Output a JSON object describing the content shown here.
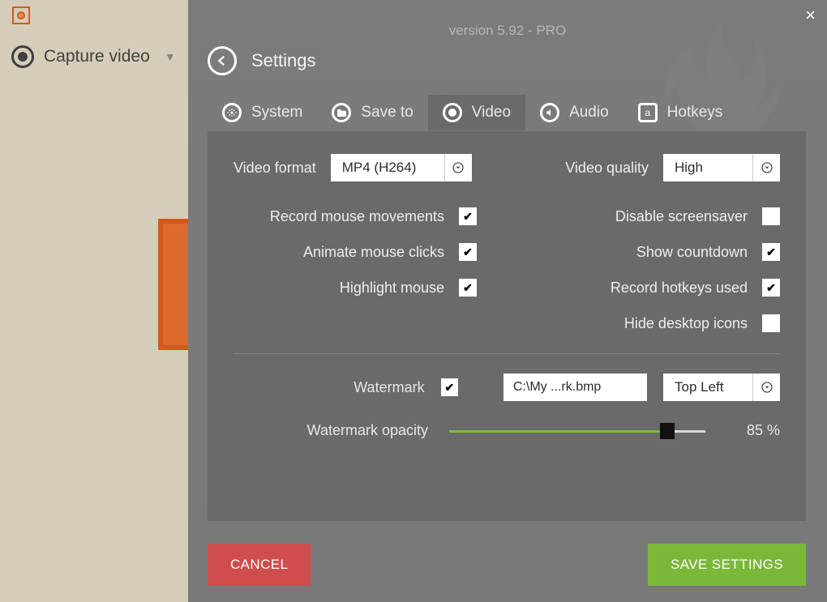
{
  "sidebar": {
    "capture_label": "Capture video"
  },
  "header": {
    "version": "version 5.92 - PRO",
    "settings": "Settings"
  },
  "tabs": {
    "system": "System",
    "saveto": "Save to",
    "video": "Video",
    "audio": "Audio",
    "hotkeys": "Hotkeys"
  },
  "video": {
    "format_label": "Video format",
    "format_value": "MP4 (H264)",
    "quality_label": "Video quality",
    "quality_value": "High",
    "left_checks": [
      {
        "label": "Record mouse movements",
        "checked": true
      },
      {
        "label": "Animate mouse clicks",
        "checked": true
      },
      {
        "label": "Highlight mouse",
        "checked": true
      }
    ],
    "right_checks": [
      {
        "label": "Disable screensaver",
        "checked": false
      },
      {
        "label": "Show countdown",
        "checked": true
      },
      {
        "label": "Record hotkeys used",
        "checked": true
      },
      {
        "label": "Hide desktop icons",
        "checked": false
      }
    ],
    "watermark_label": "Watermark",
    "watermark_checked": true,
    "watermark_path": "C:\\My ...rk.bmp",
    "watermark_position": "Top Left",
    "opacity_label": "Watermark opacity",
    "opacity_value": 85,
    "opacity_display": "85 %"
  },
  "buttons": {
    "cancel": "CANCEL",
    "save": "SAVE SETTINGS"
  }
}
